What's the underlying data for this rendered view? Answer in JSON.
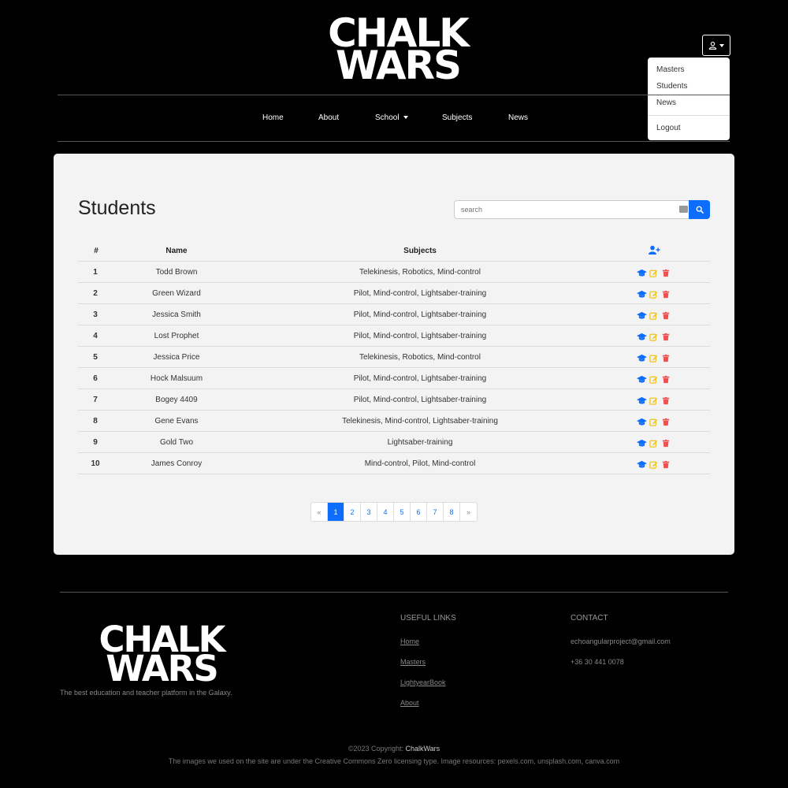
{
  "brand": {
    "line1": "CHALK",
    "line2": "WARS"
  },
  "user_menu": {
    "items": [
      "Masters",
      "Students",
      "News"
    ],
    "logout": "Logout"
  },
  "nav": {
    "home": "Home",
    "about": "About",
    "school": "School",
    "subjects": "Subjects",
    "news": "News"
  },
  "main": {
    "title": "Students",
    "search_placeholder": "search",
    "table": {
      "headers": [
        "#",
        "Name",
        "Subjects"
      ],
      "rows": [
        {
          "num": "1",
          "name": "Todd Brown",
          "subjects": "Telekinesis, Robotics, Mind-control"
        },
        {
          "num": "2",
          "name": "Green Wizard",
          "subjects": "Pilot, Mind-control, Lightsaber-training"
        },
        {
          "num": "3",
          "name": "Jessica Smith",
          "subjects": "Pilot, Mind-control, Lightsaber-training"
        },
        {
          "num": "4",
          "name": "Lost Prophet",
          "subjects": "Pilot, Mind-control, Lightsaber-training"
        },
        {
          "num": "5",
          "name": "Jessica Price",
          "subjects": "Telekinesis, Robotics, Mind-control"
        },
        {
          "num": "6",
          "name": "Hock Malsuum",
          "subjects": "Pilot, Mind-control, Lightsaber-training"
        },
        {
          "num": "7",
          "name": "Bogey 4409",
          "subjects": "Pilot, Mind-control, Lightsaber-training"
        },
        {
          "num": "8",
          "name": "Gene Evans",
          "subjects": "Telekinesis, Mind-control, Lightsaber-training"
        },
        {
          "num": "9",
          "name": "Gold Two",
          "subjects": "Lightsaber-training"
        },
        {
          "num": "10",
          "name": "James Conroy",
          "subjects": "Mind-control, Pilot, Mind-control"
        }
      ]
    },
    "pagination": {
      "prev": "«",
      "pages": [
        "1",
        "2",
        "3",
        "4",
        "5",
        "6",
        "7",
        "8"
      ],
      "active": "1",
      "next": "»"
    }
  },
  "footer": {
    "tagline": "The best education and teacher platform in the Galaxy.",
    "useful_links_heading": "USEFUL LINKS",
    "links": [
      "Home",
      "Masters",
      "LightyearBook",
      "About"
    ],
    "contact_heading": "CONTACT",
    "email": "echoangularproject@gmail.com",
    "phone": "+36 30 441 0078",
    "copyright_prefix": "©2023 Copyright: ",
    "copyright_brand": "ChalkWars",
    "images_note": "The images we used on the site are under the Creative Commons Zero licensing type. Image resources: pexels.com, unsplash.com, canva.com"
  },
  "colors": {
    "primary": "#0d6efd",
    "edit": "#f0c419",
    "delete": "#f0504f",
    "card_bg": "#f3f3f3",
    "page_bg": "#000000"
  },
  "icons": {
    "user_menu": "user-icon",
    "add_student": "user-plus-icon",
    "row_actions": [
      "graduation-cap-icon",
      "edit-icon",
      "trash-icon"
    ],
    "search": "search-icon"
  }
}
